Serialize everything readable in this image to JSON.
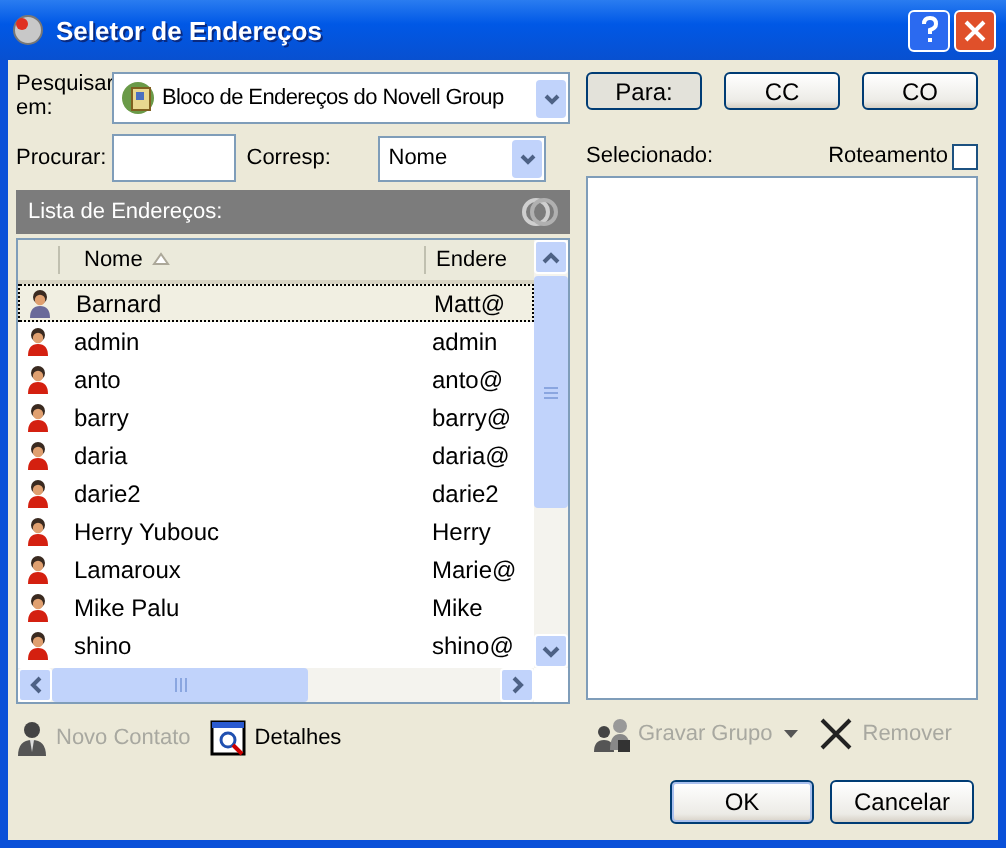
{
  "window": {
    "title": "Seletor de Endereços"
  },
  "search": {
    "look_in_label": "Pesquisar em:",
    "look_in_value": "Bloco de Endereços do Novell Group",
    "find_label": "Procurar:",
    "match_label": "Corresp:",
    "match_value": "Nome"
  },
  "address_list": {
    "title": "Lista de Endereços:",
    "columns": [
      {
        "label": "Nome",
        "sorted": true
      },
      {
        "label": "Endere",
        "sorted": false
      }
    ],
    "rows": [
      {
        "name": "Barnard",
        "address": "Matt@",
        "selected": true
      },
      {
        "name": "admin",
        "address": "admin",
        "selected": false
      },
      {
        "name": "anto",
        "address": "anto@",
        "selected": false
      },
      {
        "name": "barry",
        "address": "barry@",
        "selected": false
      },
      {
        "name": "daria",
        "address": "daria@",
        "selected": false
      },
      {
        "name": "darie2",
        "address": "darie2",
        "selected": false
      },
      {
        "name": "Herry Yubouc",
        "address": "Herry",
        "selected": false
      },
      {
        "name": "Lamaroux",
        "address": "Marie@",
        "selected": false
      },
      {
        "name": "Mike Palu",
        "address": "Mike",
        "selected": false
      },
      {
        "name": "shino",
        "address": "shino@",
        "selected": false
      }
    ]
  },
  "left_actions": [
    {
      "kind": "new-contact",
      "label": "Novo Contato",
      "disabled": true
    },
    {
      "kind": "details",
      "label": "Detalhes",
      "disabled": false
    }
  ],
  "recipient_buttons": [
    {
      "label": "Para:",
      "pressed": true
    },
    {
      "label": "CC",
      "pressed": false
    },
    {
      "label": "CO",
      "pressed": false
    }
  ],
  "selected": {
    "label": "Selecionado:",
    "routing_label": "Roteamento",
    "routing_checked": false
  },
  "right_actions": [
    {
      "kind": "save-group",
      "label": "Gravar Grupo",
      "disabled": true,
      "has_menu": true
    },
    {
      "kind": "remove",
      "label": "Remover",
      "disabled": true,
      "has_menu": false
    }
  ],
  "buttons": [
    {
      "label": "OK",
      "default": true
    },
    {
      "label": "Cancelar",
      "default": false
    }
  ]
}
